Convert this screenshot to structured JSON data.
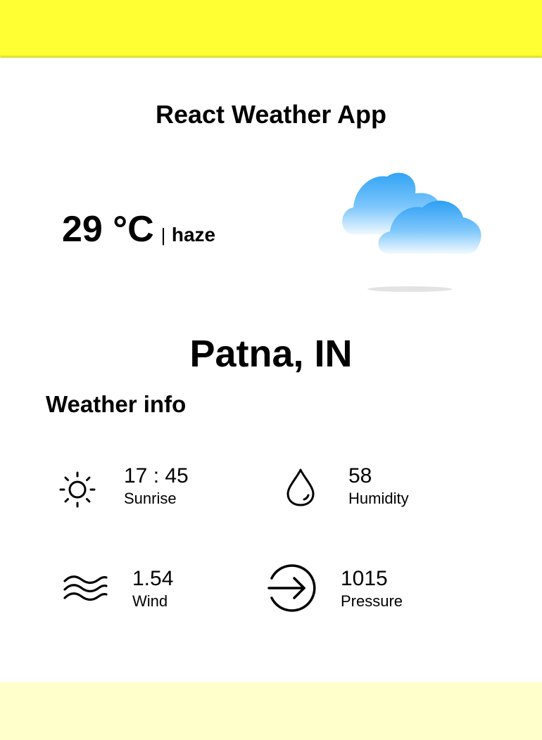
{
  "app": {
    "title": "React Weather App"
  },
  "current": {
    "temperature": "29 °C",
    "separator": "|",
    "description": "haze",
    "icon": "cloud-icon"
  },
  "location": {
    "city": "Patna, IN"
  },
  "weather_info": {
    "heading": "Weather info",
    "items": [
      {
        "value": "17 : 45",
        "label": "Sunrise",
        "icon": "sun-icon"
      },
      {
        "value": "58",
        "label": "Humidity",
        "icon": "droplet-icon"
      },
      {
        "value": "1.54",
        "label": "Wind",
        "icon": "wind-icon"
      },
      {
        "value": "1015",
        "label": "Pressure",
        "icon": "pressure-arrow-icon"
      }
    ]
  },
  "colors": {
    "top_band": "#ffff33",
    "bottom_band": "#ffffcc",
    "card": "#ffffff",
    "cloud": "#3aa6f5"
  }
}
